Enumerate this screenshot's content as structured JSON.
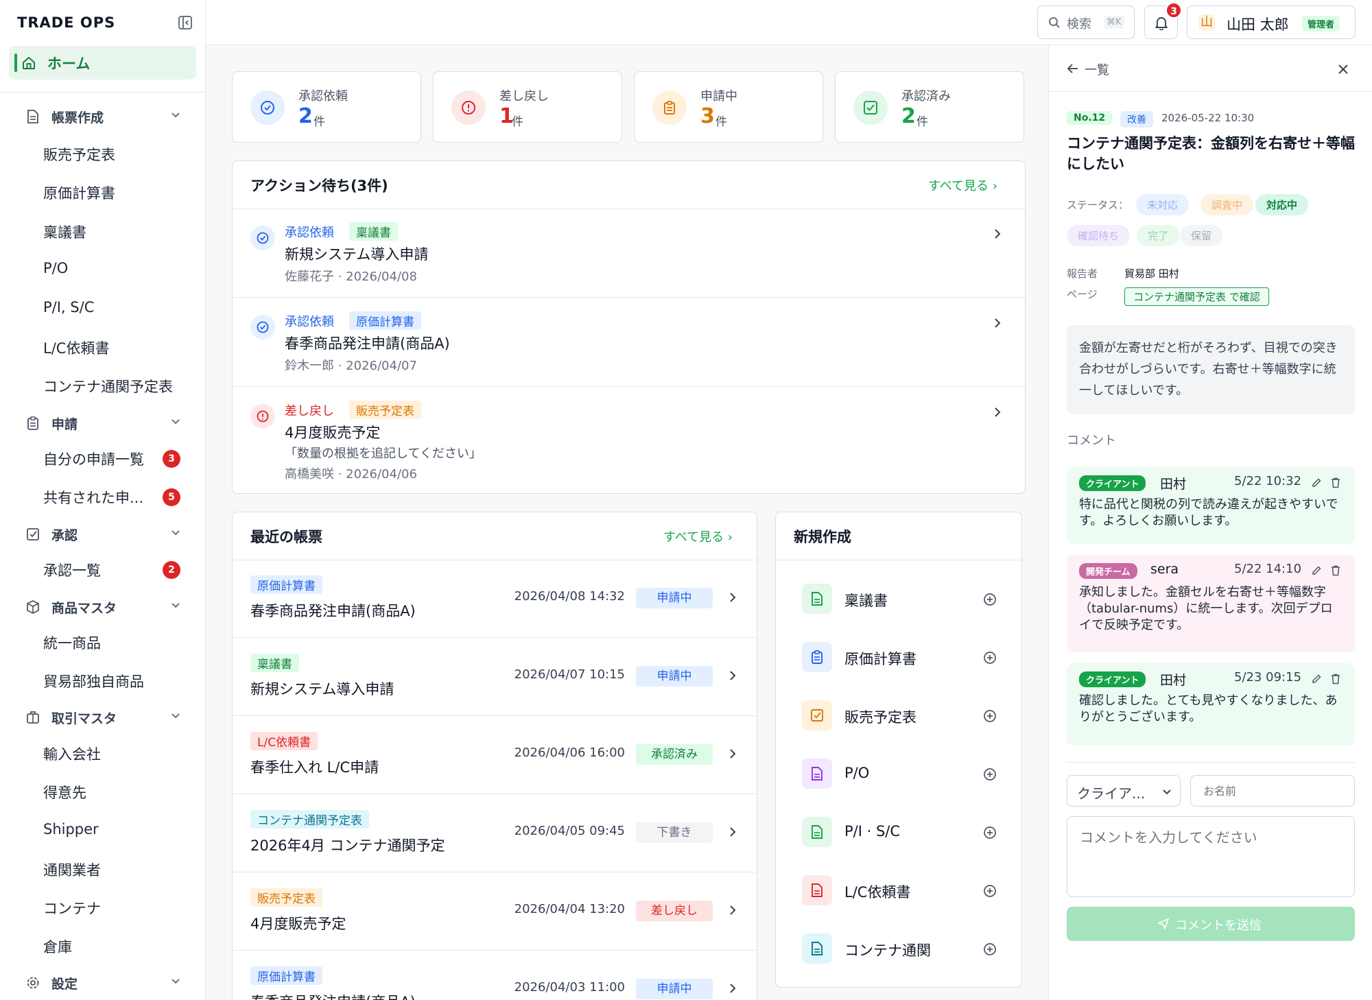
{
  "app": {
    "brand": "TRADE OPS"
  },
  "sidebar": {
    "home": "ホーム",
    "groups": [
      {
        "label": "帳票作成",
        "icon": "document-icon",
        "items": [
          {
            "label": "販売予定表"
          },
          {
            "label": "原価計算書"
          },
          {
            "label": "稟議書"
          },
          {
            "label": "P/O"
          },
          {
            "label": "P/I, S/C"
          },
          {
            "label": "L/C依頼書"
          },
          {
            "label": "コンテナ通関予定表"
          }
        ]
      },
      {
        "label": "申請",
        "icon": "clipboard-icon",
        "items": [
          {
            "label": "自分の申請一覧",
            "count": "3"
          },
          {
            "label": "共有された申...",
            "count": "5"
          }
        ]
      },
      {
        "label": "承認",
        "icon": "check-square-icon",
        "items": [
          {
            "label": "承認一覧",
            "count": "2"
          }
        ]
      },
      {
        "label": "商品マスタ",
        "icon": "box-icon",
        "items": [
          {
            "label": "統一商品"
          },
          {
            "label": "貿易部独自商品"
          }
        ]
      },
      {
        "label": "取引マスタ",
        "icon": "briefcase-icon",
        "items": [
          {
            "label": "輸入会社"
          },
          {
            "label": "得意先"
          },
          {
            "label": "Shipper"
          },
          {
            "label": "通関業者"
          },
          {
            "label": "コンテナ"
          },
          {
            "label": "倉庫"
          }
        ]
      },
      {
        "label": "設定",
        "icon": "gear-icon",
        "items": []
      }
    ]
  },
  "header": {
    "search_label": "検索",
    "search_shortcut": "⌘K",
    "notification_count": "3",
    "user_name": "山田 太郎",
    "user_role": "管理者",
    "user_avatar": "山"
  },
  "stats": [
    {
      "label": "承認依頼",
      "value": "2",
      "unit": "件",
      "color": "#2563eb"
    },
    {
      "label": "差し戻し",
      "value": "1",
      "unit": "件",
      "color": "#dc2626"
    },
    {
      "label": "申請中",
      "value": "3",
      "unit": "件",
      "color": "#d97706"
    },
    {
      "label": "承認済み",
      "value": "2",
      "unit": "件",
      "color": "#16a34a"
    }
  ],
  "actions": {
    "title": "アクション待ち(3件)",
    "see_all": "すべて見る",
    "items": [
      {
        "type": "承認依頼",
        "doc": "稟議書",
        "title": "新規システム導入申請",
        "meta": "佐藤花子 · 2026/04/08"
      },
      {
        "type": "承認依頼",
        "doc": "原価計算書",
        "title": "春季商品発注申請(商品A)",
        "meta": "鈴木一郎 · 2026/04/07"
      },
      {
        "type": "差し戻し",
        "doc": "販売予定表",
        "title": "4月度販売予定",
        "note": "「数量の根拠を追記してください」",
        "meta": "高橋美咲 · 2026/04/06"
      }
    ]
  },
  "recent": {
    "title": "最近の帳票",
    "see_all": "すべて見る",
    "items": [
      {
        "doc": "原価計算書",
        "title": "春季商品発注申請(商品A)",
        "date": "2026/04/08 14:32",
        "status": "申請中"
      },
      {
        "doc": "稟議書",
        "title": "新規システム導入申請",
        "date": "2026/04/07 10:15",
        "status": "申請中"
      },
      {
        "doc": "L/C依頼書",
        "title": "春季仕入れ L/C申請",
        "date": "2026/04/06 16:00",
        "status": "承認済み"
      },
      {
        "doc": "コンテナ通関予定表",
        "title": "2026年4月 コンテナ通関予定",
        "date": "2026/04/05 09:45",
        "status": "下書き"
      },
      {
        "doc": "販売予定表",
        "title": "4月度販売予定",
        "date": "2026/04/04 13:20",
        "status": "差し戻し"
      },
      {
        "doc": "原価計算書",
        "title": "春季商品発注申請(商品A)",
        "date": "2026/04/03 11:00",
        "status": "申請中"
      }
    ]
  },
  "new_doc": {
    "title": "新規作成",
    "items": [
      {
        "label": "稟議書"
      },
      {
        "label": "原価計算書"
      },
      {
        "label": "販売予定表"
      },
      {
        "label": "P/O"
      },
      {
        "label": "P/I · S/C"
      },
      {
        "label": "L/C依頼書"
      },
      {
        "label": "コンテナ通関"
      }
    ]
  },
  "panel": {
    "back_label": "一覧",
    "number": "No.12",
    "category": "改善",
    "datetime": "2026-05-22 10:30",
    "title": "コンテナ通関予定表：金額列を右寄せ＋等幅にしたい",
    "status_label": "ステータス：",
    "statuses": [
      "未対応",
      "調査中",
      "対応中",
      "確認待ち",
      "完了",
      "保留"
    ],
    "status_selected": "対応中",
    "reporter_label": "報告者",
    "reporter": "貿易部 田村",
    "page_label": "ページ",
    "page_link": "コンテナ通関予定表 で確認",
    "description": "金額が左寄せだと桁がそろわず、目視での突き合わせがしづらいです。右寄せ＋等幅数字に統一してほしいです。",
    "comments_label": "コメント",
    "comments": [
      {
        "role": "クライアント",
        "author": "田村",
        "time": "5/22 10:32",
        "body": "特に品代と関税の列で読み違えが起きやすいです。よろしくお願いします。"
      },
      {
        "role": "開発チーム",
        "author": "sera",
        "time": "5/22 14:10",
        "body": "承知しました。金額セルを右寄せ＋等幅数字（tabular-nums）に統一します。次回デプロイで反映予定です。"
      },
      {
        "role": "クライアント",
        "author": "田村",
        "time": "5/23 09:15",
        "body": "確認しました。とても見やすくなりました、ありがとうございます。"
      }
    ],
    "role_select": "クライア...",
    "name_placeholder": "お名前",
    "comment_placeholder": "コメントを入力してください",
    "submit_label": "コメントを送信"
  }
}
